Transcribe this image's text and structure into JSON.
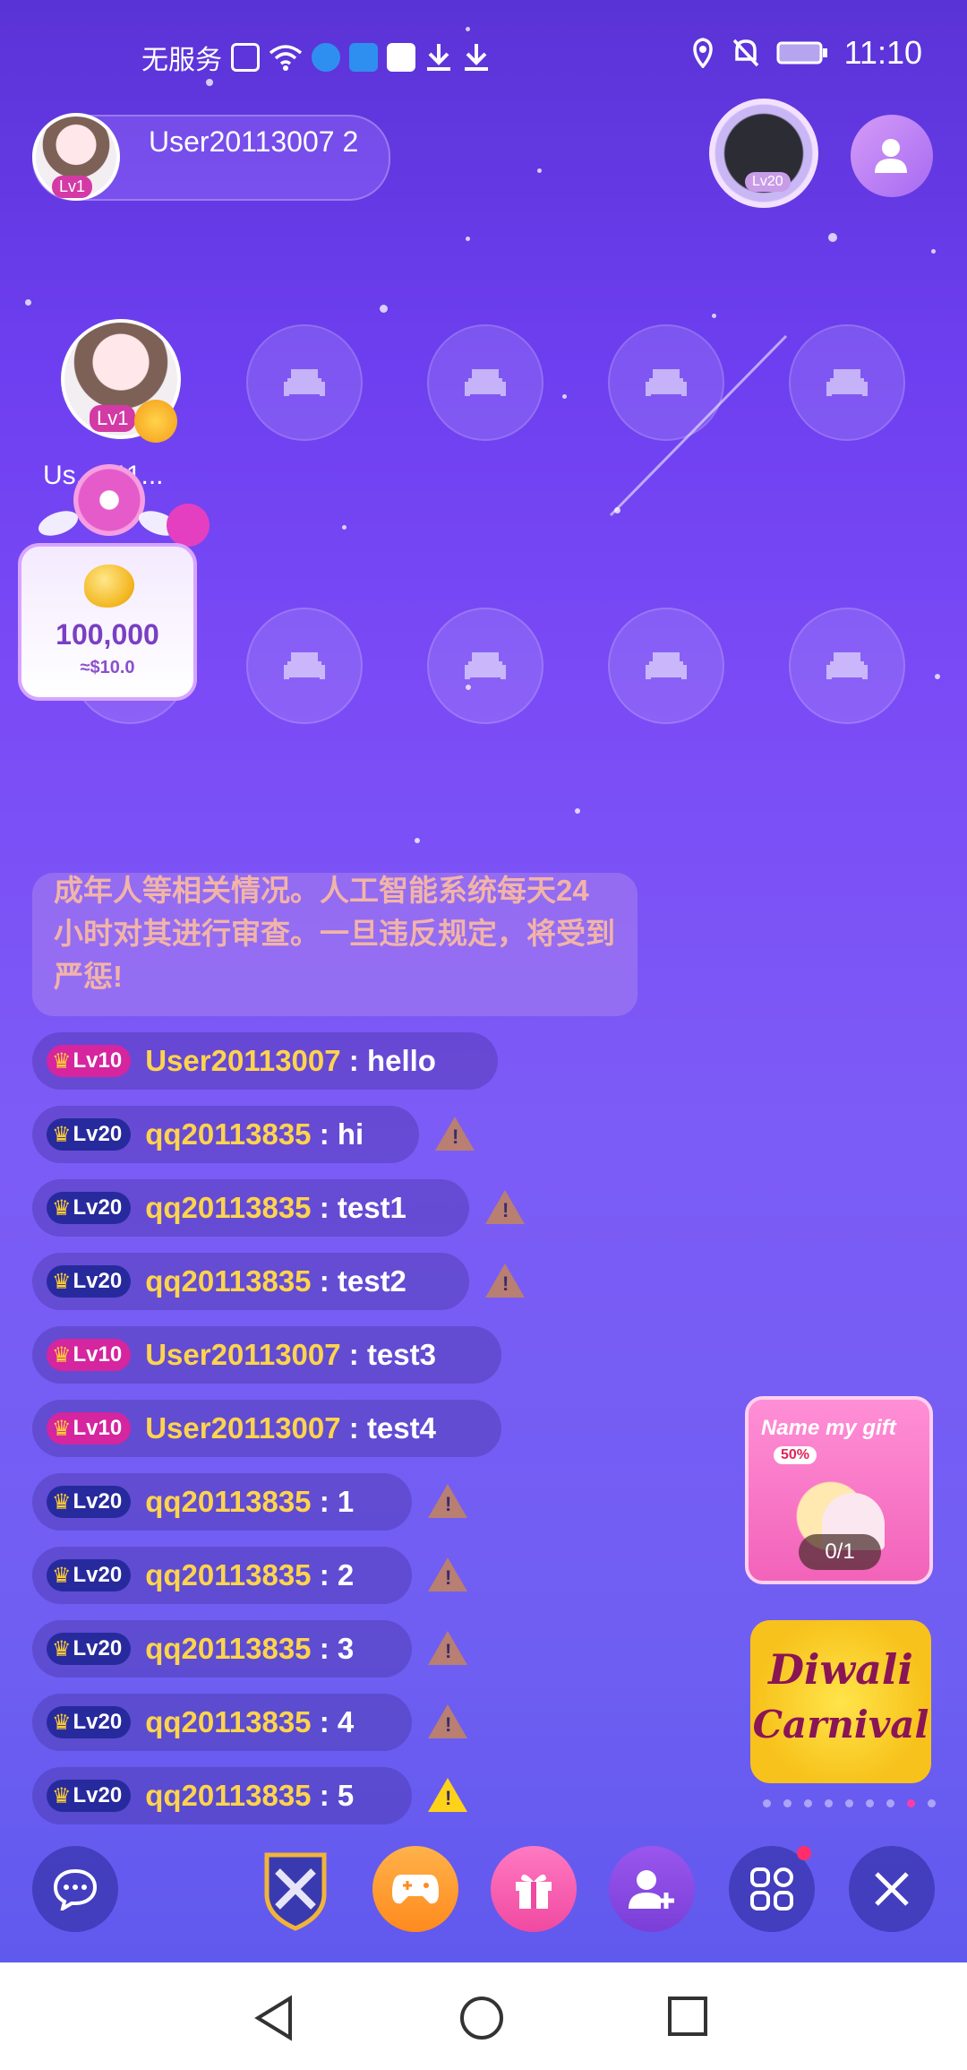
{
  "status_bar": {
    "carrier": "无服务",
    "time": "11:10",
    "left_icons": [
      "sim-alert-icon",
      "wifi-icon",
      "browser-icon",
      "globe-app-icon",
      "huawei-app-icon",
      "download-icon",
      "download-icon"
    ],
    "right_icons": [
      "location-icon",
      "mute-icon",
      "battery-icon"
    ]
  },
  "host": {
    "name": "User20113007 2",
    "level": "Lv1"
  },
  "top_right": {
    "frame_level": "Lv20"
  },
  "seats": {
    "occupied": {
      "name": "Us...011...",
      "level": "Lv1"
    },
    "empty_count": 9
  },
  "gift_popup": {
    "amount": "100,000",
    "usd": "≈$10.0"
  },
  "notice": {
    "text": "成年人等相关情况。人工智能系统每天24 小时对其进行审查。一旦违反规定，将受到严惩!"
  },
  "messages": [
    {
      "level": "Lv10",
      "level_color": "#d5259f",
      "user": "User20113007",
      "text": "hello",
      "warning": false
    },
    {
      "level": "Lv20",
      "level_color": "#272a9c",
      "user": "qq20113835",
      "text": "hi",
      "warning": true
    },
    {
      "level": "Lv20",
      "level_color": "#272a9c",
      "user": "qq20113835",
      "text": "test1",
      "warning": true
    },
    {
      "level": "Lv20",
      "level_color": "#272a9c",
      "user": "qq20113835",
      "text": "test2",
      "warning": true
    },
    {
      "level": "Lv10",
      "level_color": "#d5259f",
      "user": "User20113007",
      "text": "test3",
      "warning": false
    },
    {
      "level": "Lv10",
      "level_color": "#d5259f",
      "user": "User20113007",
      "text": "test4",
      "warning": false
    },
    {
      "level": "Lv20",
      "level_color": "#272a9c",
      "user": "qq20113835",
      "text": "1",
      "warning": true
    },
    {
      "level": "Lv20",
      "level_color": "#272a9c",
      "user": "qq20113835",
      "text": "2",
      "warning": true
    },
    {
      "level": "Lv20",
      "level_color": "#272a9c",
      "user": "qq20113835",
      "text": "3",
      "warning": true
    },
    {
      "level": "Lv20",
      "level_color": "#272a9c",
      "user": "qq20113835",
      "text": "4",
      "warning": true
    },
    {
      "level": "Lv20",
      "level_color": "#272a9c",
      "user": "qq20113835",
      "text": "5",
      "warning": true
    }
  ],
  "promo": {
    "name_my_gift": "Name my gift",
    "discount": "50%",
    "progress": "0/1",
    "diwali_line1": "Diwali",
    "diwali_line2": "Carnival"
  },
  "bottom_bar": [
    "chat-icon",
    "battle-icon",
    "game-icon",
    "gift-icon",
    "add-user-icon",
    "apps-icon",
    "close-icon"
  ],
  "colors": {
    "accent_gold": "#ffd44d",
    "pink_level": "#d5259f",
    "navy_level": "#272a9c"
  }
}
